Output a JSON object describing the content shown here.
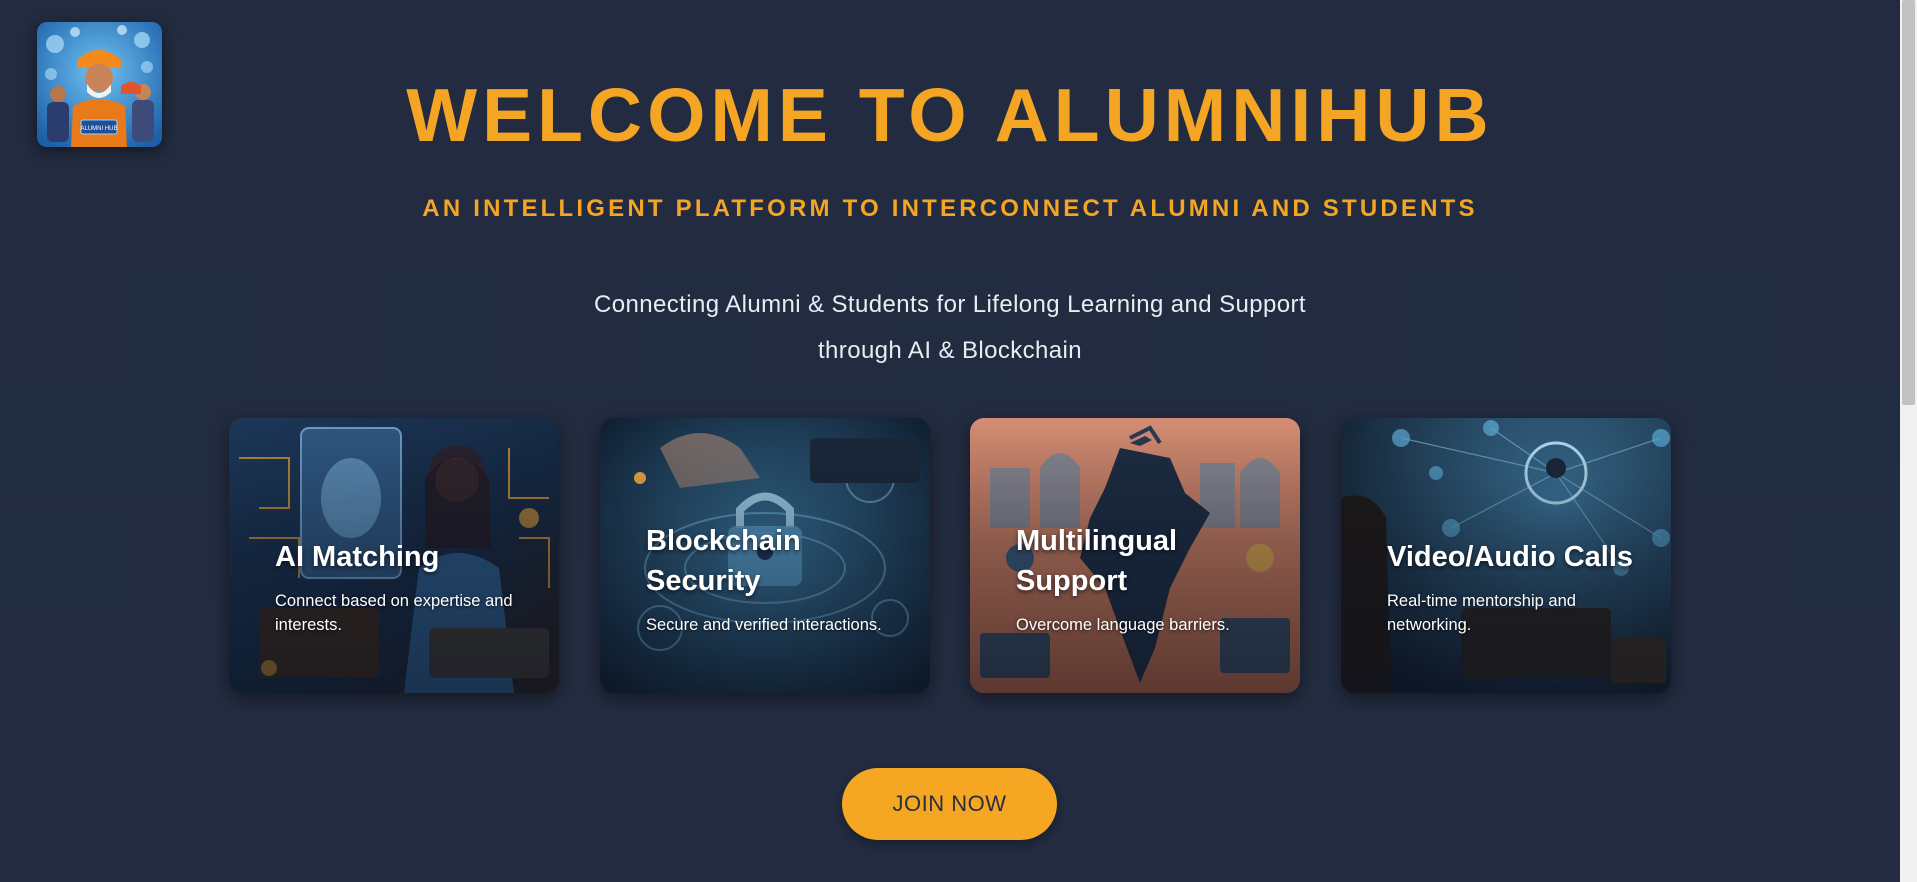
{
  "header": {
    "title": "WELCOME TO ALUMNIHUB",
    "subtitle": "AN INTELLIGENT PLATFORM TO INTERCONNECT ALUMNI AND STUDENTS",
    "tagline_line1": "Connecting Alumni & Students for Lifelong Learning and Support",
    "tagline_line2": "through AI & Blockchain"
  },
  "logo": {
    "badge_text": "ALUMNI HUB",
    "icon": "alumnihub-logo-icon"
  },
  "features": [
    {
      "title": "AI Matching",
      "description": "Connect based on expertise and interests.",
      "image": "ai-matching-illustration"
    },
    {
      "title": "Blockchain Security",
      "description": "Secure and verified interactions.",
      "image": "blockchain-lock-illustration"
    },
    {
      "title": "Multilingual Support",
      "description": "Overcome language barriers.",
      "image": "india-map-illustration"
    },
    {
      "title": "Video/Audio Calls",
      "description": "Real-time mentorship and networking.",
      "image": "video-call-network-illustration"
    }
  ],
  "cta": {
    "label": "JOIN NOW"
  },
  "colors": {
    "background": "#222b3f",
    "accent": "#f5a524",
    "text": "#e8ecf3"
  }
}
